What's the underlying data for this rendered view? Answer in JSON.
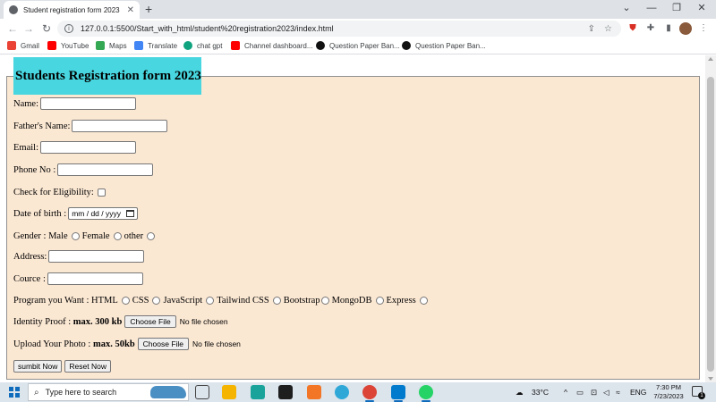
{
  "browser": {
    "tab_title": "Student registration form 2023",
    "tab_close": "✕",
    "new_tab": "+",
    "window_controls": [
      "⌄",
      "—",
      "❐",
      "✕"
    ],
    "url": "127.0.0.1:5500/Start_with_html/student%20registration2023/index.html",
    "bookmarks": [
      {
        "label": "Gmail",
        "icon": "gmail-icon",
        "color": "#ea4335"
      },
      {
        "label": "YouTube",
        "icon": "youtube-icon",
        "color": "#ff0000"
      },
      {
        "label": "Maps",
        "icon": "maps-icon",
        "color": "#34a853"
      },
      {
        "label": "Translate",
        "icon": "translate-icon",
        "color": "#4285f4"
      },
      {
        "label": "chat gpt",
        "icon": "chatgpt-icon",
        "color": "#10a37f"
      },
      {
        "label": "Channel dashboard...",
        "icon": "youtube-icon",
        "color": "#ff0000"
      },
      {
        "label": "Question Paper Ban...",
        "icon": "a-icon",
        "color": "#111111"
      },
      {
        "label": "Question Paper Ban...",
        "icon": "a-icon",
        "color": "#111111"
      }
    ]
  },
  "form": {
    "legend": "Students Registration form 2023",
    "name_label": "Name:",
    "father_label": "Father's Name:",
    "email_label": "Email:",
    "phone_label": "Phone No :",
    "eligibility_label": "Check for Eligibility:",
    "dob_label": "Date of birth :",
    "dob_placeholder": "mm / dd / yyyy",
    "gender_label": "Gender :",
    "gender_options": [
      "Male",
      "Female",
      "other"
    ],
    "address_label": "Address:",
    "course_label": "Cource :",
    "program_label": "Program you Want :",
    "program_options": [
      "HTML",
      "CSS",
      "JavaScript",
      "Tailwind CSS",
      "Bootstrap",
      "MongoDB",
      "Express"
    ],
    "identity_label": "Identity Proof :",
    "identity_limit": "max. 300 kb",
    "photo_label": "Upload Your Photo :",
    "photo_limit": "max. 50kb",
    "choose_file": "Choose File",
    "no_file": "No file chosen",
    "submit_label": "sumbit Now",
    "reset_label": "Reset Now"
  },
  "taskbar": {
    "search_placeholder": "Type here to search",
    "temperature": "33°C",
    "language": "ENG",
    "time": "7:30 PM",
    "date": "7/23/2023",
    "notification_count": "1"
  }
}
